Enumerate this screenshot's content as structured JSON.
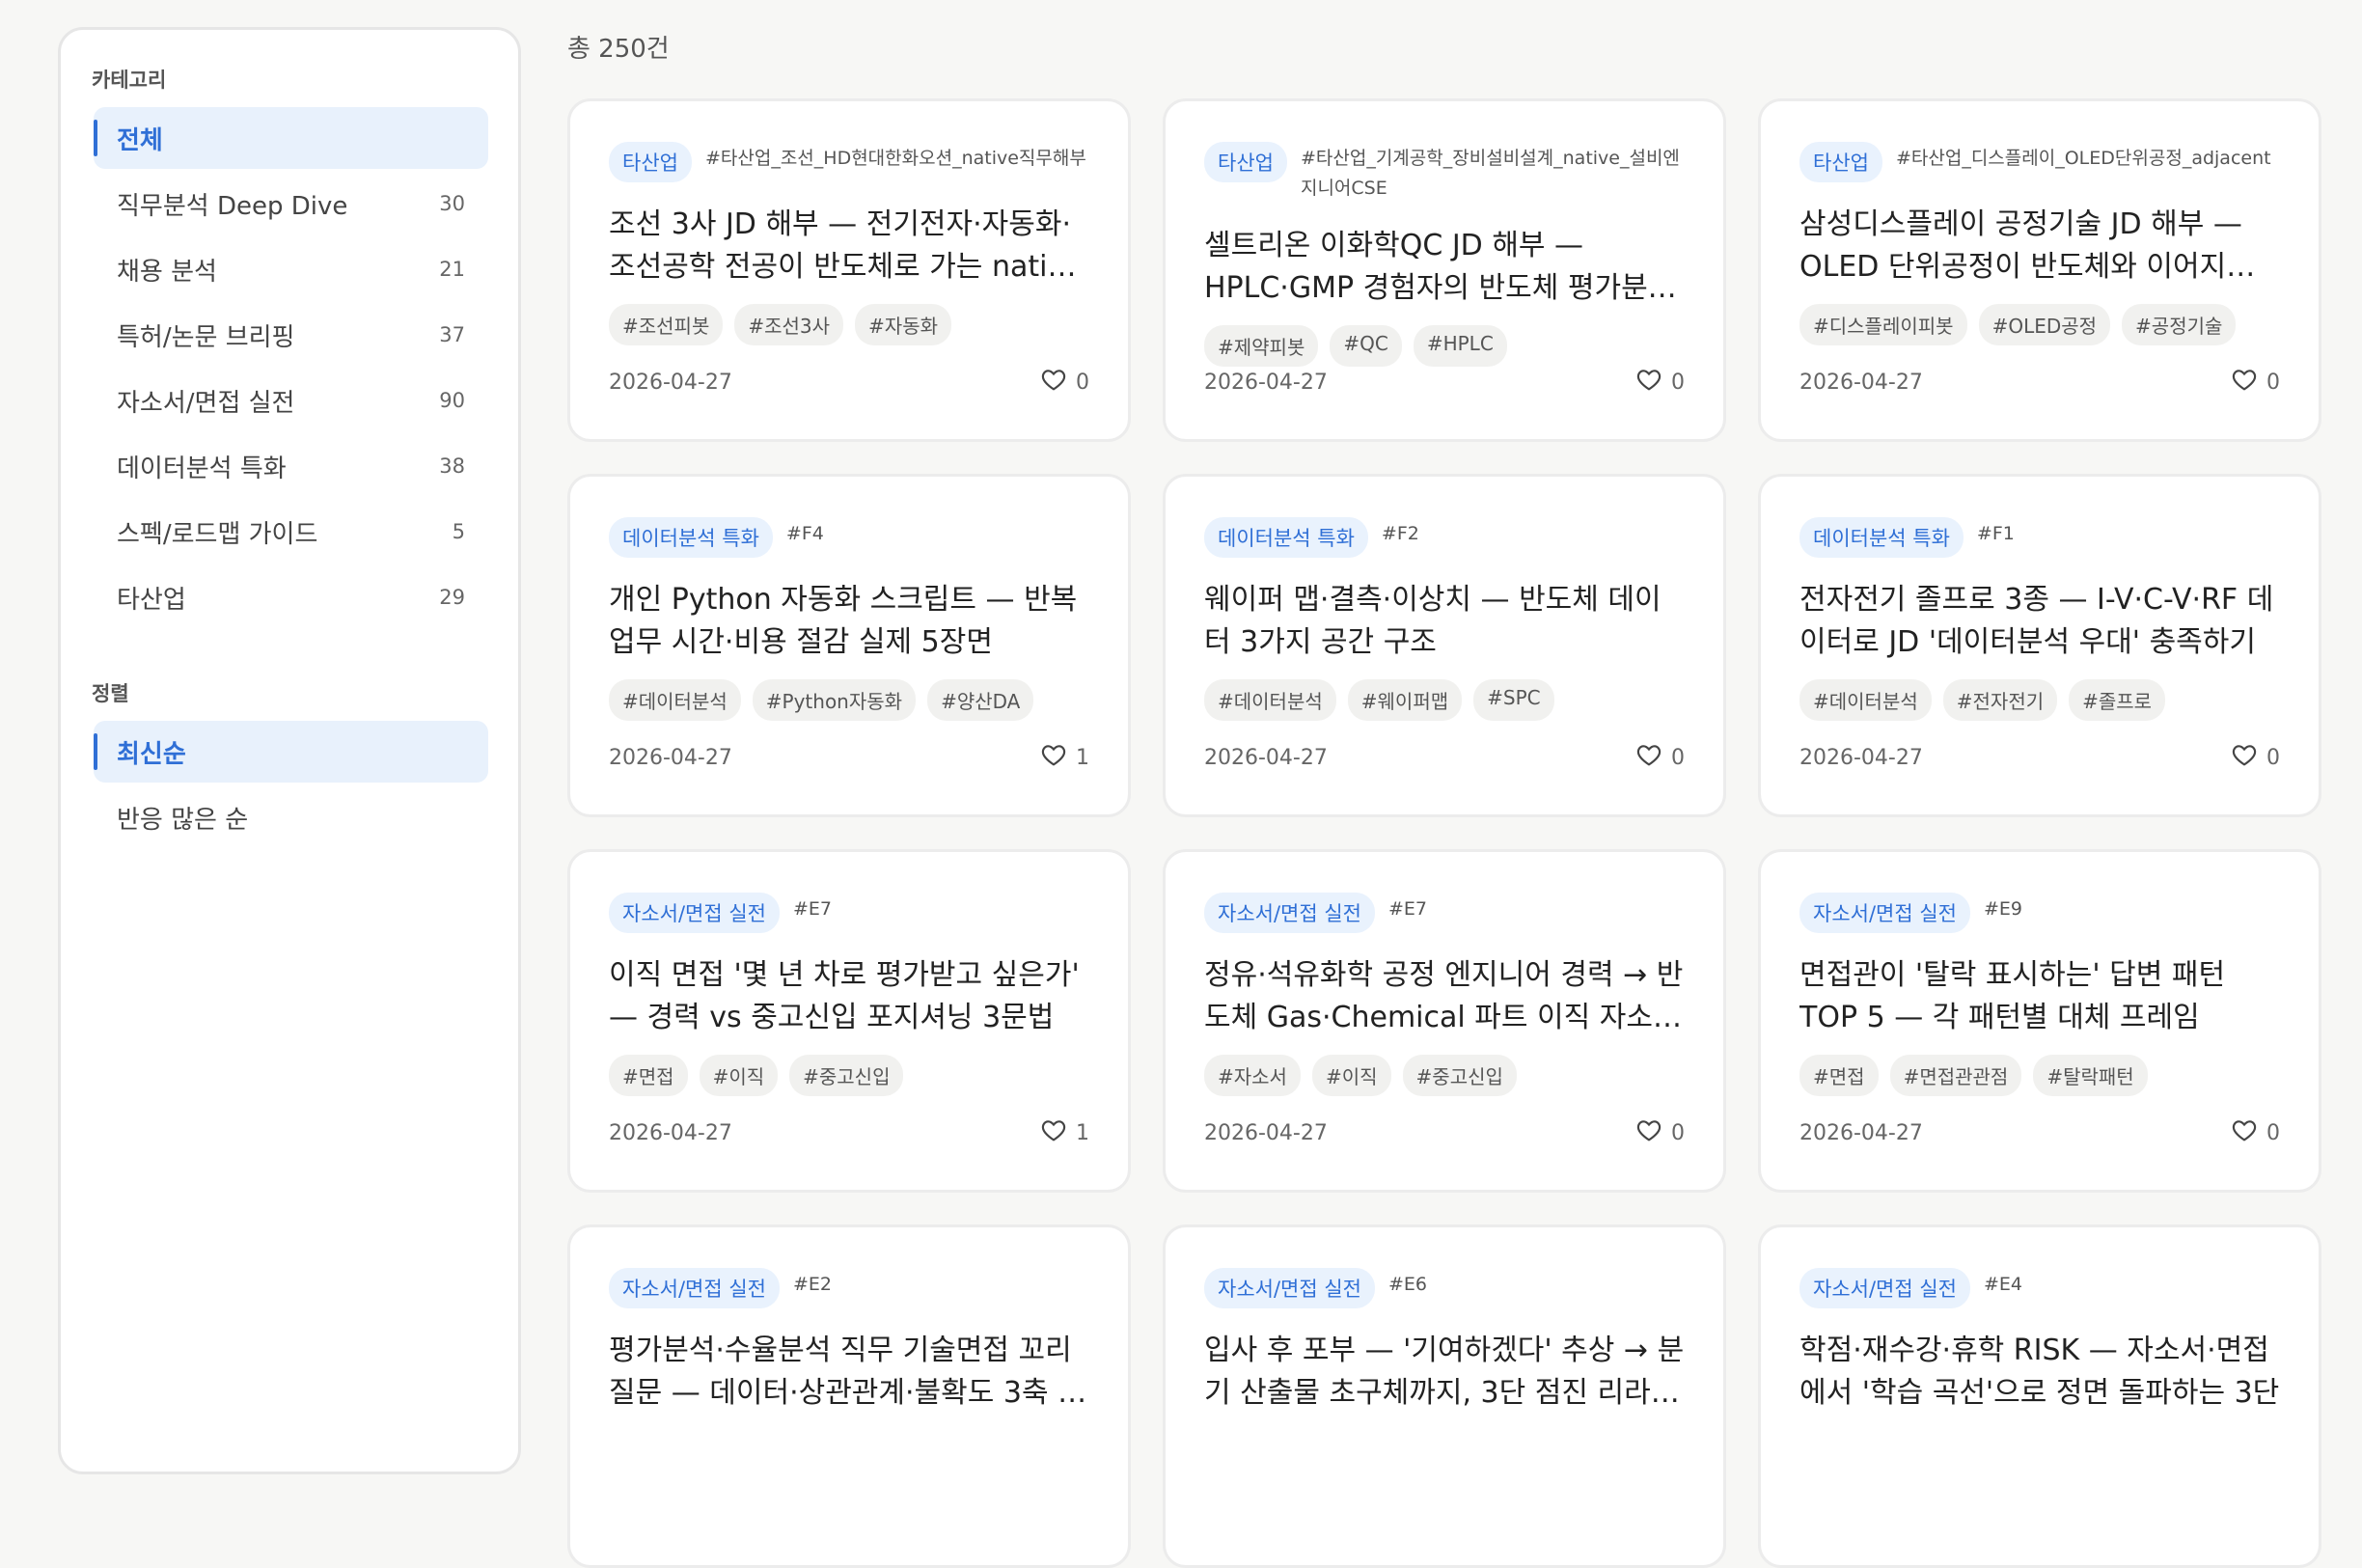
{
  "sidebar": {
    "category_heading": "카테고리",
    "categories": [
      {
        "label": "전체",
        "count": "",
        "active": true
      },
      {
        "label": "직무분석 Deep Dive",
        "count": "30"
      },
      {
        "label": "채용 분석",
        "count": "21"
      },
      {
        "label": "특허/논문 브리핑",
        "count": "37"
      },
      {
        "label": "자소서/면접 실전",
        "count": "90"
      },
      {
        "label": "데이터분석 특화",
        "count": "38"
      },
      {
        "label": "스펙/로드맵 가이드",
        "count": "5"
      },
      {
        "label": "타산업",
        "count": "29"
      }
    ],
    "sort_heading": "정렬",
    "sorts": [
      {
        "label": "최신순",
        "active": true
      },
      {
        "label": "반응 많은 순"
      }
    ]
  },
  "main": {
    "total": "총 250건",
    "cards": [
      {
        "badge": "타산업",
        "code": "#타산업_조선_HD현대한화오션_native직무해부",
        "title": "조선 3사 JD 해부 — 전기전자·자동화·조선공학 전공이 반도체로 가는 native …",
        "tags": [
          "#조선피봇",
          "#조선3사",
          "#자동화"
        ],
        "date": "2026-04-27",
        "likes": "0"
      },
      {
        "badge": "타산업",
        "code": "#타산업_기계공학_장비설비설계_native_설비엔지니어CSE",
        "title": "셀트리온 이화학QC JD 해부 — HPLC·GMP 경험자의 반도체 평가분…",
        "tags": [
          "#제약피봇",
          "#QC",
          "#HPLC"
        ],
        "date": "2026-04-27",
        "likes": "0"
      },
      {
        "badge": "타산업",
        "code": "#타산업_디스플레이_OLED단위공정_adjacent",
        "title": "삼성디스플레이 공정기술 JD 해부 — OLED 단위공정이 반도체와 이어지는 …",
        "tags": [
          "#디스플레이피봇",
          "#OLED공정",
          "#공정기술"
        ],
        "date": "2026-04-27",
        "likes": "0"
      },
      {
        "badge": "데이터분석 특화",
        "code": "#F4",
        "title": "개인 Python 자동화 스크립트 — 반복 업무 시간·비용 절감 실제 5장면",
        "tags": [
          "#데이터분석",
          "#Python자동화",
          "#양산DA"
        ],
        "date": "2026-04-27",
        "likes": "1"
      },
      {
        "badge": "데이터분석 특화",
        "code": "#F2",
        "title": "웨이퍼 맵·결측·이상치 — 반도체 데이터 3가지 공간 구조",
        "tags": [
          "#데이터분석",
          "#웨이퍼맵",
          "#SPC"
        ],
        "date": "2026-04-27",
        "likes": "0"
      },
      {
        "badge": "데이터분석 특화",
        "code": "#F1",
        "title": "전자전기 졸프로 3종 — I-V·C-V·RF 데이터로 JD '데이터분석 우대' 충족하기",
        "tags": [
          "#데이터분석",
          "#전자전기",
          "#졸프로"
        ],
        "date": "2026-04-27",
        "likes": "0"
      },
      {
        "badge": "자소서/면접 실전",
        "code": "#E7",
        "title": "이직 면접 '몇 년 차로 평가받고 싶은가' — 경력 vs 중고신입 포지셔닝 3문법",
        "tags": [
          "#면접",
          "#이직",
          "#중고신입"
        ],
        "date": "2026-04-27",
        "likes": "1"
      },
      {
        "badge": "자소서/면접 실전",
        "code": "#E7",
        "title": "정유·석유화학 공정 엔지니어 경력 → 반도체 Gas·Chemical 파트 이직 자소서…",
        "tags": [
          "#자소서",
          "#이직",
          "#중고신입"
        ],
        "date": "2026-04-27",
        "likes": "0"
      },
      {
        "badge": "자소서/면접 실전",
        "code": "#E9",
        "title": "면접관이 '탈락 표시하는' 답변 패턴 TOP 5 — 각 패턴별 대체 프레임",
        "tags": [
          "#면접",
          "#면접관관점",
          "#탈락패턴"
        ],
        "date": "2026-04-27",
        "likes": "0"
      },
      {
        "badge": "자소서/면접 실전",
        "code": "#E2",
        "title": "평가분석·수율분석 직무 기술면접 꼬리질문 — 데이터·상관관계·불확도 3축 …",
        "tags": [],
        "date": "",
        "likes": ""
      },
      {
        "badge": "자소서/면접 실전",
        "code": "#E6",
        "title": "입사 후 포부 — '기여하겠다' 추상 → 분기 산출물 초구체까지, 3단 점진 리라…",
        "tags": [],
        "date": "",
        "likes": ""
      },
      {
        "badge": "자소서/면접 실전",
        "code": "#E4",
        "title": "학점·재수강·휴학 RISK — 자소서·면접에서 '학습 곡선'으로 정면 돌파하는 3단",
        "tags": [],
        "date": "",
        "likes": ""
      }
    ]
  },
  "colors": {
    "accent": "#2f6fd6",
    "badge_bg": "#e9f2fd",
    "tag_bg": "#f1f1ef"
  },
  "icons": {
    "like": "heart-icon"
  }
}
